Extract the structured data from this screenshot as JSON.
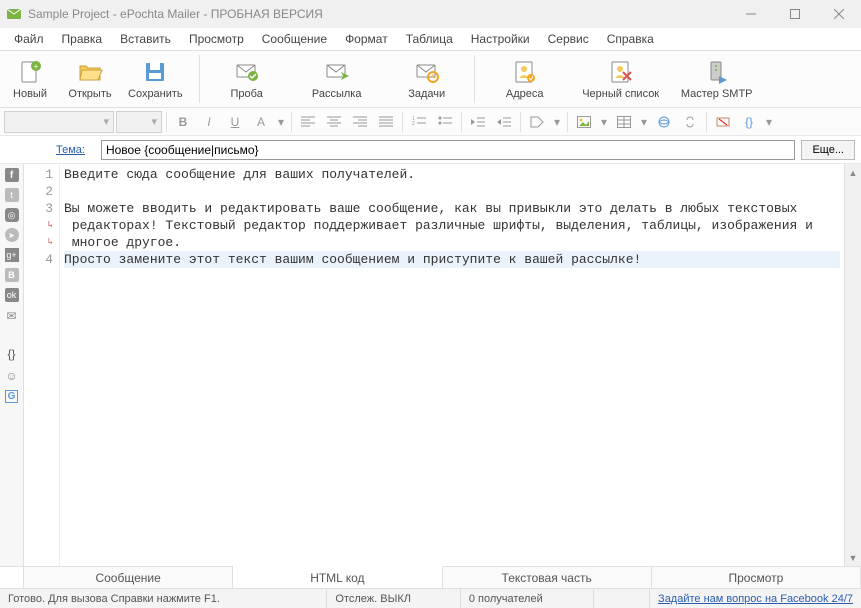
{
  "title": "Sample Project - ePochta Mailer - ПРОБНАЯ ВЕРСИЯ",
  "menu": [
    "Файл",
    "Правка",
    "Вставить",
    "Просмотр",
    "Сообщение",
    "Формат",
    "Таблица",
    "Настройки",
    "Сервис",
    "Справка"
  ],
  "toolbar": [
    {
      "id": "new",
      "label": "Новый"
    },
    {
      "id": "open",
      "label": "Открыть"
    },
    {
      "id": "save",
      "label": "Сохранить"
    },
    {
      "id": "probe",
      "label": "Проба"
    },
    {
      "id": "send",
      "label": "Рассылка"
    },
    {
      "id": "tasks",
      "label": "Задачи"
    },
    {
      "id": "addr",
      "label": "Адреса"
    },
    {
      "id": "black",
      "label": "Черный список"
    },
    {
      "id": "smtp",
      "label": "Мастер SMTP"
    }
  ],
  "subject": {
    "label": "Тема:",
    "value": "Новое {сообщение|письмо}",
    "more": "Еще..."
  },
  "editor": {
    "lines": [
      {
        "n": "1",
        "wrap": false,
        "text": "Введите сюда сообщение для ваших получателей."
      },
      {
        "n": "2",
        "wrap": false,
        "text": ""
      },
      {
        "n": "3",
        "wrap": false,
        "text": "Вы можете вводить и редактировать ваше сообщение, как вы привыкли это делать в любых текстовых"
      },
      {
        "n": "",
        "wrap": true,
        "text": " редакторах! Текстовый редактор поддерживает различные шрифты, выделения, таблицы, изображения и"
      },
      {
        "n": "",
        "wrap": true,
        "text": " многое другое."
      },
      {
        "n": "4",
        "wrap": false,
        "text": "Просто замените этот текст вашим сообщением и приступите к вашей рассылке!",
        "hl": true
      }
    ]
  },
  "tabs": [
    "Сообщение",
    "HTML код",
    "Текстовая часть",
    "Просмотр"
  ],
  "active_tab": 1,
  "status": {
    "ready": "Готово. Для вызова Справки нажмите F1.",
    "track": "Отслеж. ВЫКЛ",
    "recip": "0 получателей",
    "fb": "Задайте нам вопрос на Facebook 24/7"
  }
}
